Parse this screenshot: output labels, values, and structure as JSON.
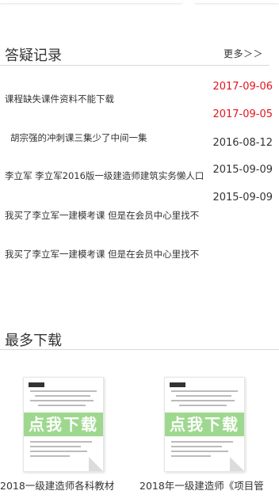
{
  "qa": {
    "title": "答疑记录",
    "more": "更多＞＞",
    "items": [
      {
        "text": "课程缺失课件资料不能下载",
        "date": "2017-09-06",
        "date_color": "#e0151c"
      },
      {
        "text": "胡宗强的冲刺课三集少了中间一集",
        "date": "2017-09-05",
        "date_color": "#e0151c"
      },
      {
        "text": "李立军 李立军2016版一级建造师建筑实务懒人口",
        "date": "2016-08-12",
        "date_color": "#333333"
      },
      {
        "text": "我买了李立军一建模考课 但是在会员中心里找不",
        "date": "2015-09-09",
        "date_color": "#333333"
      },
      {
        "text": "我买了李立军一建模考课 但是在会员中心里找不",
        "date": "2015-09-09",
        "date_color": "#333333"
      }
    ]
  },
  "downloads": {
    "title": "最多下载",
    "banner": "点我下载",
    "items": [
      {
        "name": "2018一级建造师各科教材"
      },
      {
        "name": "2018年一级建造师《项目管"
      }
    ]
  }
}
